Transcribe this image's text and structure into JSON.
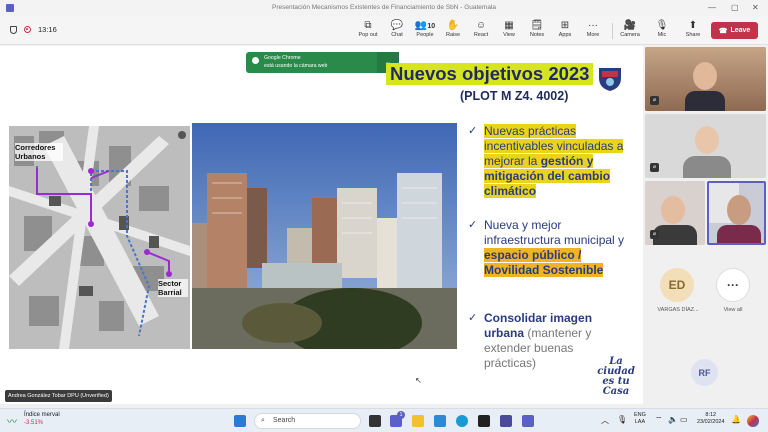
{
  "window": {
    "title": "Presentación Mecanismos Existentes de Financiamiento de SbN - Guatemala"
  },
  "toolbar": {
    "timer": "13:16",
    "buttons": [
      {
        "label": "Pop out"
      },
      {
        "label": "Chat"
      },
      {
        "label": "People",
        "count": "10"
      },
      {
        "label": "Raise"
      },
      {
        "label": "React"
      },
      {
        "label": "View"
      },
      {
        "label": "Notes"
      },
      {
        "label": "Apps"
      },
      {
        "label": "More"
      },
      {
        "label": "Camera"
      },
      {
        "label": "Mic"
      },
      {
        "label": "Share"
      }
    ],
    "leave_label": "Leave"
  },
  "notification": {
    "app": "Google Chrome",
    "message": "está usando la cámara web"
  },
  "slide": {
    "title": "Nuevos objetivos 2023",
    "subtitle": "(PLOT M Z4. 4002)",
    "map_labels": {
      "corredores": "Corredores Urbanos",
      "sector": "Sector Barrial"
    },
    "bullets": [
      {
        "pre": "Nuevas prácticas incentivables vinculadas a mejorar la ",
        "bold": "gestión y mitigación del cambio climático"
      },
      {
        "pre": "Nueva y mejor infraestructura municipal y ",
        "bold": "espacio público / Movilidad Sostenible"
      },
      {
        "bold": "Consolidar imagen urbana",
        "post": " (mantener y extender buenas prácticas)"
      }
    ],
    "signature": "La ciudad es tu Casa"
  },
  "speaker_label": "Andrea González Tobar DPU (Unverified)",
  "participants": {
    "ed_initials": "ED",
    "ed_name": "VARGAS DÍAZ...",
    "view_all_label": "View all",
    "rf_initials": "RF"
  },
  "taskbar": {
    "weather_title": "Índice merval",
    "weather_value": "-3.51%",
    "search_placeholder": "Search",
    "lang": "ENG",
    "lang2": "LAA",
    "time": "8:12",
    "date": "23/02/2024",
    "badge": "1"
  },
  "colors": {
    "accent": "#d6e51f",
    "leave": "#c4314b",
    "navy": "#2a3b80",
    "notice": "#2a8a4a"
  }
}
